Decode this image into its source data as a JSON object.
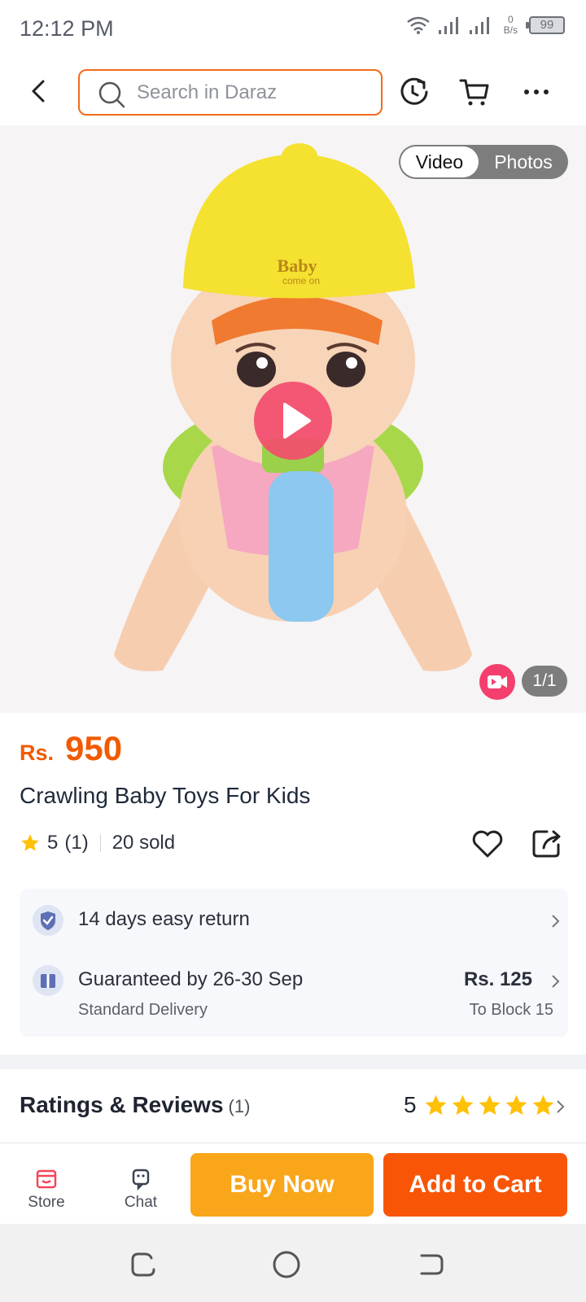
{
  "status_bar": {
    "time": "12:12 PM",
    "net_speed_value": "0",
    "net_speed_unit": "B/s",
    "battery": "99"
  },
  "header": {
    "search_placeholder": "Search in Daraz",
    "icons": [
      "back-icon",
      "history-icon",
      "cart-icon",
      "more-icon"
    ]
  },
  "media": {
    "toggle_video": "Video",
    "toggle_photos": "Photos",
    "counter": "1/1",
    "toy_cap_text_line1": "Baby",
    "toy_cap_text_line2": "come on"
  },
  "product": {
    "currency": "Rs.",
    "price": "950",
    "title": "Crawling Baby Toys For Kids",
    "rating": "5",
    "rating_count": "(1)",
    "sold": "20 sold"
  },
  "delivery": {
    "return_text": "14 days easy return",
    "guarantee_text": "Guaranteed by 26-30 Sep",
    "delivery_type": "Standard Delivery",
    "fee": "Rs. 125",
    "destination": "To Block 15"
  },
  "reviews": {
    "title": "Ratings & Reviews",
    "count": "(1)",
    "score": "5",
    "stars": 5
  },
  "action_bar": {
    "store_label": "Store",
    "chat_label": "Chat",
    "buy_now_label": "Buy Now",
    "add_to_cart_label": "Add to Cart"
  },
  "colors": {
    "brand_orange": "#f85606",
    "buy_now_yellow": "#faa61a",
    "price_orange": "#f15a00",
    "star_yellow": "#ffc107",
    "play_pink": "#f34c6c"
  }
}
